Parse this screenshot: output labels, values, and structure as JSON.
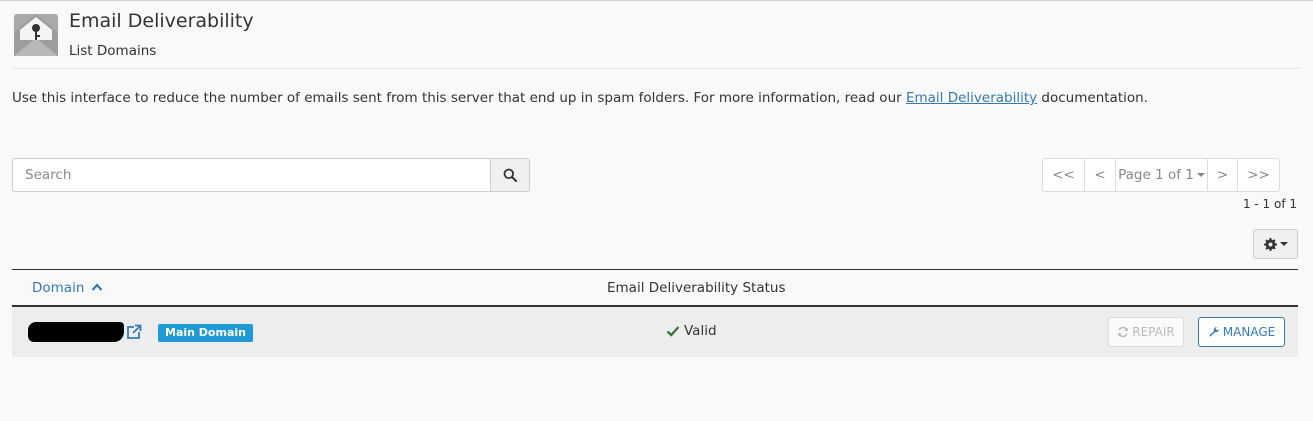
{
  "header": {
    "title": "Email Deliverability",
    "subtitle": "List Domains"
  },
  "intro": {
    "text_before": "Use this interface to reduce the number of emails sent from this server that end up in spam folders. For more information, read our ",
    "link_text": "Email Deliverability",
    "text_after": " documentation."
  },
  "search": {
    "placeholder": "Search",
    "value": ""
  },
  "pagination": {
    "first": "<<",
    "prev": "<",
    "page_label": "Page 1 of 1",
    "next": ">",
    "last": ">>",
    "range": "1 - 1 of 1"
  },
  "table": {
    "columns": {
      "domain": "Domain",
      "status": "Email Deliverability Status"
    },
    "rows": [
      {
        "domain": "",
        "badge": "Main Domain",
        "status": "Valid",
        "repair_label": "REPAIR",
        "manage_label": "MANAGE"
      }
    ]
  },
  "icons": {
    "app": "envelope-key-icon",
    "search": "search-icon",
    "settings": "gear-icon",
    "sort": "chevron-up-icon",
    "external": "external-link-icon",
    "valid": "check-icon",
    "repair": "refresh-icon",
    "manage": "wrench-icon"
  },
  "colors": {
    "link": "#337ab7",
    "badge": "#1e9bd6",
    "valid": "#3c763d"
  }
}
